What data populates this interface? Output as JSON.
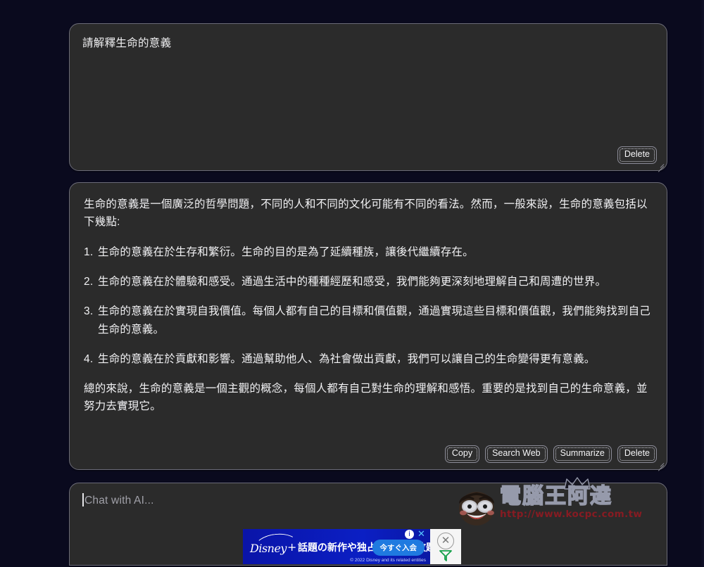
{
  "theme": {
    "page_background": "#0a0a1e",
    "card_background": "#2b2b2b",
    "card_border": "#6b6b78",
    "text_color": "#f2f2f4",
    "placeholder_color": "#a0a0a8",
    "ad_background": "#0b1bb8",
    "ad_cta_background": "#1f7ae0",
    "watermark_url_color": "#8e1a22"
  },
  "prompt_card": {
    "text": "請解釋生命的意義",
    "delete_label": "Delete"
  },
  "answer_card": {
    "intro": "生命的意義是一個廣泛的哲學問題，不同的人和不同的文化可能有不同的看法。然而，一般來說，生命的意義包括以下幾點:",
    "items": [
      {
        "number": "1.",
        "text": "生命的意義在於生存和繁衍。生命的目的是為了延續種族，讓後代繼續存在。"
      },
      {
        "number": "2.",
        "text": "生命的意義在於體驗和感受。通過生活中的種種經歷和感受，我們能夠更深刻地理解自己和周遭的世界。"
      },
      {
        "number": "3.",
        "text": "生命的意義在於實現自我價值。每個人都有自己的目標和價值觀，通過實現這些目標和價值觀，我們能夠找到自己生命的意義。"
      },
      {
        "number": "4.",
        "text": "生命的意義在於貢獻和影響。通過幫助他人、為社會做出貢獻，我們可以讓自己的生命變得更有意義。"
      }
    ],
    "conclusion": "總的來說，生命的意義是一個主觀的概念，每個人都有自己對生命的理解和感悟。重要的是找到自己的生命意義，並努力去實現它。",
    "buttons": [
      {
        "label": "Copy",
        "name": "copy-button"
      },
      {
        "label": "Search Web",
        "name": "search-web-button"
      },
      {
        "label": "Summarize",
        "name": "summarize-button"
      },
      {
        "label": "Delete",
        "name": "delete-button"
      }
    ]
  },
  "chat_input": {
    "value": "",
    "placeholder": "Chat with AI..."
  },
  "watermark": {
    "title": "電腦王阿達",
    "url": "http://www.kocpc.com.tw"
  },
  "ad": {
    "brand": "Disney",
    "brand_plus": "+",
    "headline": "話題の新作や独占作品が見放題!",
    "cta": "今すぐ入会",
    "legal": "© 2022 Disney and its related entities",
    "info_glyph": "i",
    "close_glyph": "✕",
    "dismiss_glyph": "✕"
  }
}
